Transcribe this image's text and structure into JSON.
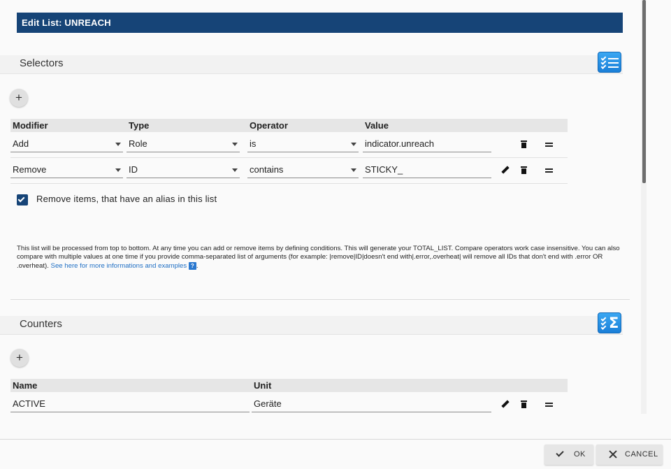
{
  "dialog": {
    "title": "Edit List: UNREACH"
  },
  "selectors": {
    "title": "Selectors",
    "add_label": "+",
    "columns": [
      "Modifier",
      "Type",
      "Operator",
      "Value"
    ],
    "rows": [
      {
        "modifier": "Add",
        "type": "Role",
        "operator": "is",
        "value": "indicator.unreach"
      },
      {
        "modifier": "Remove",
        "type": "ID",
        "operator": "contains",
        "value": "STICKY_"
      }
    ],
    "alias_checkbox": {
      "checked": true,
      "label": "Remove items, that have an alias in this list"
    },
    "info": {
      "text": "This list will be processed from top to bottom. At any time you can add or remove items by defining conditions. This will generate your TOTAL_LIST. Compare operators work case insensitive. You can also compare with multiple values at one time if you provide comma-separated list of arguments (for example: |remove|ID|doesn't end with|.error,.overheat| will remove all IDs that don't end with .error OR .overheat).",
      "link": "See here for more informations and examples",
      "help": "?",
      "end": "."
    }
  },
  "counters": {
    "title": "Counters",
    "add_label": "+",
    "columns": [
      "Name",
      "Unit"
    ],
    "rows": [
      {
        "name": "ACTIVE",
        "unit": "Geräte"
      }
    ]
  },
  "footer": {
    "ok_label": "OK",
    "cancel_label": "CANCEL"
  },
  "colors": {
    "title_bar": "#164477",
    "accent_icon": "#1a7fd8",
    "link": "#1f6fc4"
  },
  "icons": [
    "checklist-icon",
    "sigma-list-icon",
    "caret-down-icon",
    "trash-icon",
    "drag-handle-icon",
    "pencil-icon",
    "check-icon",
    "close-icon",
    "help-icon"
  ]
}
